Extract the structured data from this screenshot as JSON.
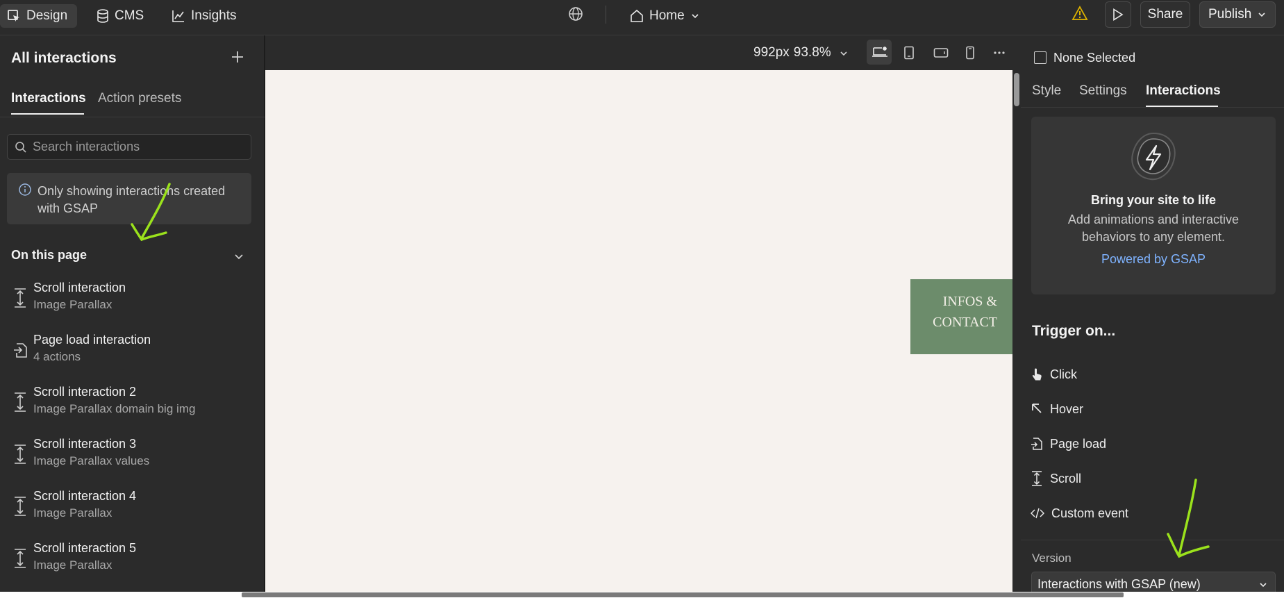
{
  "topbar": {
    "design": "Design",
    "cms": "CMS",
    "insights": "Insights",
    "page": "Home",
    "share": "Share",
    "publish": "Publish"
  },
  "left": {
    "title": "All interactions",
    "tabs": [
      "Interactions",
      "Action presets"
    ],
    "search_placeholder": "Search interactions",
    "info": "Only showing interactions created with GSAP",
    "section": "On this page",
    "items": [
      {
        "title": "Scroll interaction",
        "sub": "Image Parallax",
        "icon": "scroll-icon"
      },
      {
        "title": "Page load interaction",
        "sub": "4 actions",
        "icon": "page-load-icon"
      },
      {
        "title": "Scroll interaction 2",
        "sub": "Image Parallax domain big img",
        "icon": "scroll-icon"
      },
      {
        "title": "Scroll interaction 3",
        "sub": "Image Parallax values",
        "icon": "scroll-icon"
      },
      {
        "title": "Scroll interaction 4",
        "sub": "Image Parallax",
        "icon": "scroll-icon"
      },
      {
        "title": "Scroll interaction 5",
        "sub": "Image Parallax",
        "icon": "scroll-icon"
      }
    ]
  },
  "canvas": {
    "size": "992px",
    "zoom": "93.8%",
    "infos_line1": "INFOS &",
    "infos_line2": "CONTACT"
  },
  "right": {
    "selection": "None Selected",
    "tabs": [
      "Style",
      "Settings",
      "Interactions"
    ],
    "card_title": "Bring your site to life",
    "card_text": "Add animations and interactive behaviors to any element.",
    "card_link": "Powered by GSAP",
    "trigger_title": "Trigger on...",
    "triggers": [
      {
        "label": "Click",
        "icon": "click-icon"
      },
      {
        "label": "Hover",
        "icon": "hover-icon"
      },
      {
        "label": "Page load",
        "icon": "page-load-icon"
      },
      {
        "label": "Scroll",
        "icon": "scroll-icon"
      },
      {
        "label": "Custom event",
        "icon": "code-icon"
      }
    ],
    "version_label": "Version",
    "version_value": "Interactions with GSAP (new)"
  },
  "colors": {
    "accent_link": "#7fb3ff",
    "warning": "#e0b400",
    "annotation": "#9be21c",
    "canvas_bg": "#f6f2ee",
    "card_green": "#6c8c6b"
  }
}
